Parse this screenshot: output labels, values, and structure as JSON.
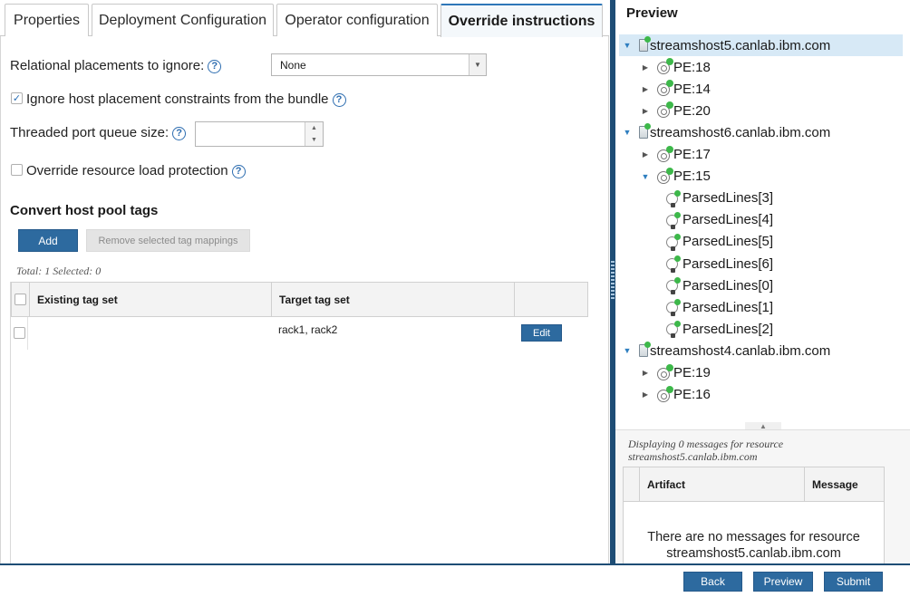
{
  "tabs": [
    {
      "label": "Properties",
      "active": false
    },
    {
      "label": "Deployment Configuration",
      "active": false
    },
    {
      "label": "Operator configuration",
      "active": false
    },
    {
      "label": "Override instructions",
      "active": true
    }
  ],
  "form": {
    "relational_label": "Relational placements to ignore:",
    "relational_value": "None",
    "ignore_host_label": "Ignore host placement constraints from the bundle",
    "ignore_host_checked": true,
    "threaded_label": "Threaded port queue size:",
    "threaded_value": "",
    "override_load_label": "Override resource load protection",
    "override_load_checked": false,
    "help_glyph": "?"
  },
  "hostpool": {
    "heading": "Convert host pool tags",
    "add_label": "Add",
    "remove_label": "Remove selected tag mappings",
    "total_text": "Total: 1 Selected: 0",
    "columns": [
      "Existing tag set",
      "Target tag set",
      ""
    ],
    "rows": [
      {
        "existing": "",
        "target": "rack1, rack2",
        "action": "Edit"
      }
    ]
  },
  "preview": {
    "title": "Preview",
    "tree": [
      {
        "type": "host",
        "label": "streamshost5.canlab.ibm.com",
        "expanded": true,
        "selected": true,
        "level": 0
      },
      {
        "type": "pe",
        "label": "PE:18",
        "expanded": false,
        "level": 1
      },
      {
        "type": "pe",
        "label": "PE:14",
        "expanded": false,
        "level": 1
      },
      {
        "type": "pe",
        "label": "PE:20",
        "expanded": false,
        "level": 1
      },
      {
        "type": "host",
        "label": "streamshost6.canlab.ibm.com",
        "expanded": true,
        "level": 0
      },
      {
        "type": "pe",
        "label": "PE:17",
        "expanded": false,
        "level": 1
      },
      {
        "type": "pe",
        "label": "PE:15",
        "expanded": true,
        "level": 1
      },
      {
        "type": "op",
        "label": "ParsedLines[3]",
        "level": 2
      },
      {
        "type": "op",
        "label": "ParsedLines[4]",
        "level": 2
      },
      {
        "type": "op",
        "label": "ParsedLines[5]",
        "level": 2
      },
      {
        "type": "op",
        "label": "ParsedLines[6]",
        "level": 2
      },
      {
        "type": "op",
        "label": "ParsedLines[0]",
        "level": 2
      },
      {
        "type": "op",
        "label": "ParsedLines[1]",
        "level": 2
      },
      {
        "type": "op",
        "label": "ParsedLines[2]",
        "level": 2
      },
      {
        "type": "host",
        "label": "streamshost4.canlab.ibm.com",
        "expanded": true,
        "level": 0
      },
      {
        "type": "pe",
        "label": "PE:19",
        "expanded": false,
        "level": 1
      },
      {
        "type": "pe",
        "label": "PE:16",
        "expanded": false,
        "level": 1
      }
    ],
    "messages": {
      "displaying": "Displaying 0 messages for resource streamshost5.canlab.ibm.com",
      "col_artifact": "Artifact",
      "col_message": "Message",
      "empty_text": "There are no messages for resource streamshost5.canlab.ibm.com"
    }
  },
  "footer": {
    "back": "Back",
    "preview": "Preview",
    "submit": "Submit"
  },
  "colors": {
    "accent": "#2d6a9f",
    "splitter": "#1e4d75",
    "status_green": "#3db84a",
    "selected_row": "#d7e9f6"
  }
}
